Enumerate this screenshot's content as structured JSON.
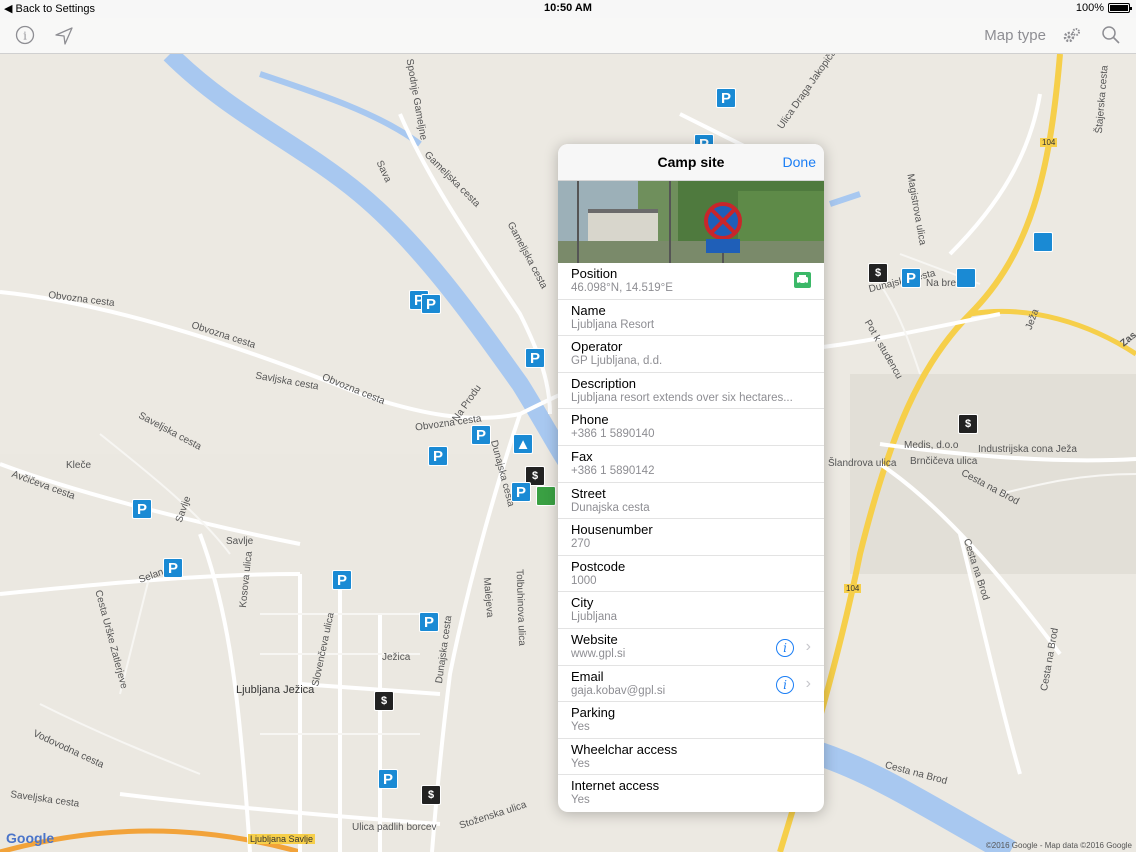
{
  "status": {
    "back": "Back to Settings",
    "time": "10:50 AM",
    "battery": "100%"
  },
  "toolbar": {
    "map_type": "Map type"
  },
  "map": {
    "labels": [
      "Sava",
      "Obvozna cesta",
      "Obvozna cesta",
      "Obvozna cesta",
      "Obvozna cesta",
      "Gameljska cesta",
      "Gameljska cesta",
      "Spodnje Gameljne",
      "Savljska cesta",
      "Saveljska cesta",
      "Na Produ",
      "Dunajska cesta",
      "Dunajska cesta",
      "Dunajska cesta",
      "Avčičeva cesta",
      "Kleče",
      "Savlje",
      "Savlje",
      "Selanova",
      "Ljubljana Ježica",
      "Ljubljana Savlje",
      "Ulica padlih borcev",
      "Stoženska ulica",
      "Vodovodna cesta",
      "Saveljska cesta",
      "Cesta Urške Zatlerjeve",
      "Ježica",
      "Malejeva",
      "Tolbuhinova ulica",
      "Slovenčeva ulica",
      "Kosova ulica",
      "Ulica Draga Jakopiča",
      "Medis, d.o.o",
      "Industrijska cona Ježa",
      "Šlandrova ulica",
      "Brnčičeva ulica",
      "Cesta na Brod",
      "Cesta na Brod",
      "Cesta na Brod",
      "Cesta na Brod",
      "Na brežini",
      "Dunajska cesta",
      "Ježa",
      "Štajerska cesta",
      "104",
      "104",
      "Magistrova ulica",
      "Pot k studencu",
      "Zas"
    ],
    "google": "Google",
    "copyright": "©2016 Google - Map data ©2016 Google"
  },
  "popover": {
    "title": "Camp site",
    "done": "Done",
    "rows": [
      {
        "label": "Position",
        "value": "46.098°N, 14.519°E"
      },
      {
        "label": "Name",
        "value": "Ljubljana Resort"
      },
      {
        "label": "Operator",
        "value": "GP Ljubljana, d.d."
      },
      {
        "label": "Description",
        "value": "Ljubljana resort extends over six hectares..."
      },
      {
        "label": "Phone",
        "value": "+386 1 5890140"
      },
      {
        "label": "Fax",
        "value": "+386 1 5890142"
      },
      {
        "label": "Street",
        "value": "Dunajska cesta"
      },
      {
        "label": "Housenumber",
        "value": "270"
      },
      {
        "label": "Postcode",
        "value": "1000"
      },
      {
        "label": "City",
        "value": "Ljubljana"
      },
      {
        "label": "Website",
        "value": "www.gpl.si"
      },
      {
        "label": "Email",
        "value": "gaja.kobav@gpl.si"
      },
      {
        "label": "Parking",
        "value": "Yes"
      },
      {
        "label": "Wheelchar access",
        "value": "Yes"
      },
      {
        "label": "Internet access",
        "value": "Yes"
      }
    ]
  },
  "pins": {
    "parking": "P",
    "atm": "$",
    "camp": "▲"
  },
  "colors": {
    "accent": "#1b7ef5",
    "pin": "#1a8ad4",
    "river": "#a8c8f0",
    "road_major": "#f6cf4a"
  }
}
